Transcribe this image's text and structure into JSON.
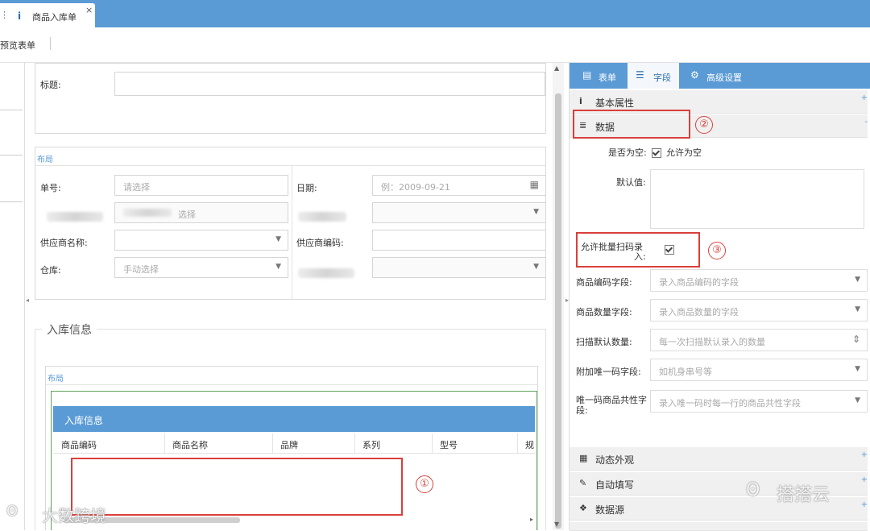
{
  "tab": {
    "title": "商品入库单",
    "close": "×",
    "info_icon": "i",
    "left_icon": "⋮"
  },
  "toolbar": {
    "preview_label": "预览表单"
  },
  "form": {
    "title_label": "标题:",
    "layout_label": "布局",
    "fields": {
      "order_no_label": "单号:",
      "order_no_placeholder": "请选择",
      "date_label": "日期:",
      "date_placeholder": "例：2009-09-21",
      "select_placeholder": "选择",
      "supplier_name_label": "供应商名称:",
      "supplier_code_label": "供应商编码:",
      "warehouse_label": "仓库:",
      "warehouse_placeholder": "手动选择"
    },
    "section_title": "入库信息",
    "inner_layout_label": "布局",
    "table_title": "入库信息",
    "table_columns": [
      "商品编码",
      "商品名称",
      "品牌",
      "系列",
      "型号",
      "规"
    ]
  },
  "panel": {
    "tabs": [
      {
        "label": "表单",
        "icon": "form-icon"
      },
      {
        "label": "字段",
        "icon": "list-icon"
      },
      {
        "label": "高级设置",
        "icon": "gear-icon"
      }
    ],
    "sections": {
      "basic": "基本属性",
      "data": "数据",
      "appearance": "动态外观",
      "autofill": "自动填写",
      "datasource": "数据源"
    },
    "allow_empty_label": "是否为空:",
    "allow_empty_text": "允许为空",
    "default_label": "默认值:",
    "batch_scan_label_1": "允许批量扫码录",
    "batch_scan_label_2": "入:",
    "rows": [
      {
        "label": "商品编码字段:",
        "placeholder": "录入商品编码的字段",
        "control": "▼"
      },
      {
        "label": "商品数量字段:",
        "placeholder": "录入商品数量的字段",
        "control": "▼"
      },
      {
        "label": "扫描默认数量:",
        "placeholder": "每一次扫描默认录入的数量",
        "control": "⇕"
      },
      {
        "label": "附加唯一码字段:",
        "placeholder": "如机身串号等",
        "control": "▼"
      },
      {
        "label": "唯一码商品共性字段:",
        "placeholder": "录入唯一码时每一行的商品共性字段",
        "control": "▼"
      }
    ]
  },
  "annotations": {
    "one": "①",
    "two": "②",
    "three": "③"
  },
  "watermarks": {
    "left": "大数跨境",
    "right": "搭搭云"
  },
  "colors": {
    "accent": "#5b9bd5",
    "annotation": "#d9403b"
  }
}
